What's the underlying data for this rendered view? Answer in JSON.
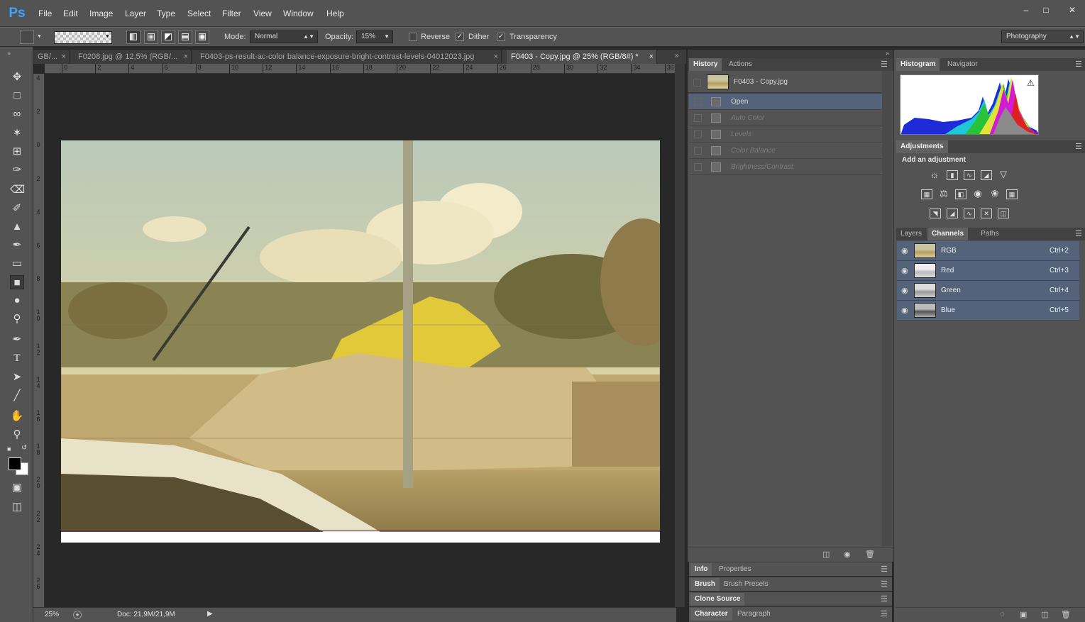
{
  "app": {
    "logo": "Ps"
  },
  "menu": [
    "File",
    "Edit",
    "Image",
    "Layer",
    "Type",
    "Select",
    "Filter",
    "View",
    "Window",
    "Help"
  ],
  "options": {
    "mode_label": "Mode:",
    "mode_value": "Normal",
    "opacity_label": "Opacity:",
    "opacity_value": "15%",
    "reverse": "Reverse",
    "dither": "Dither",
    "transparency": "Transparency",
    "workspace": "Photography"
  },
  "tabs": [
    "GB/...",
    "F0208.jpg @ 12,5% (RGB/...",
    "F0403-ps-result-ac-color balance-exposure-bright-contrast-levels-04012023.jpg",
    "F0403 - Copy.jpg @ 25% (RGB/8#) *"
  ],
  "ruler_top": [
    "0",
    "2",
    "4",
    "6",
    "8",
    "10",
    "12",
    "14",
    "16",
    "18",
    "20",
    "22",
    "24",
    "26",
    "28",
    "30",
    "32",
    "34",
    "36"
  ],
  "ruler_left": [
    "4",
    "2",
    "0",
    "2",
    "4",
    "6",
    "8",
    "10",
    "12",
    "14",
    "16",
    "18",
    "20",
    "22",
    "24",
    "26"
  ],
  "status": {
    "zoom": "25%",
    "doc": "Doc: 21,9M/21,9M"
  },
  "history": {
    "tabs": [
      "History",
      "Actions"
    ],
    "snapshot": "F0403 - Copy.jpg",
    "steps": [
      "Open",
      "Auto Color",
      "Levels",
      "Color Balance",
      "Brightness/Contrast"
    ]
  },
  "histogram": {
    "tabs": [
      "Histogram",
      "Navigator"
    ]
  },
  "adjustments": {
    "title": "Adjustments",
    "subtitle": "Add an adjustment"
  },
  "channels": {
    "tabs": [
      "Layers",
      "Channels",
      "Paths"
    ],
    "rows": [
      {
        "name": "RGB",
        "shortcut": "Ctrl+2"
      },
      {
        "name": "Red",
        "shortcut": "Ctrl+3"
      },
      {
        "name": "Green",
        "shortcut": "Ctrl+4"
      },
      {
        "name": "Blue",
        "shortcut": "Ctrl+5"
      }
    ]
  },
  "collapsed_panels": [
    [
      "Info",
      "Properties"
    ],
    [
      "Brush",
      "Brush Presets"
    ],
    [
      "Clone Source"
    ],
    [
      "Character",
      "Paragraph"
    ]
  ],
  "colors": {
    "accent": "#3fa3ff",
    "selection": "#54637a",
    "bg": "#535353"
  },
  "icons": [
    "move-icon",
    "marquee-icon",
    "lasso-icon",
    "magic-wand-icon",
    "crop-icon",
    "eyedropper-icon",
    "healing-icon",
    "brush-icon",
    "stamp-icon",
    "history-brush-icon",
    "eraser-icon",
    "gradient-icon",
    "blur-icon",
    "dodge-icon",
    "pen-icon",
    "type-icon",
    "path-select-icon",
    "line-icon",
    "hand-icon",
    "zoom-icon"
  ]
}
